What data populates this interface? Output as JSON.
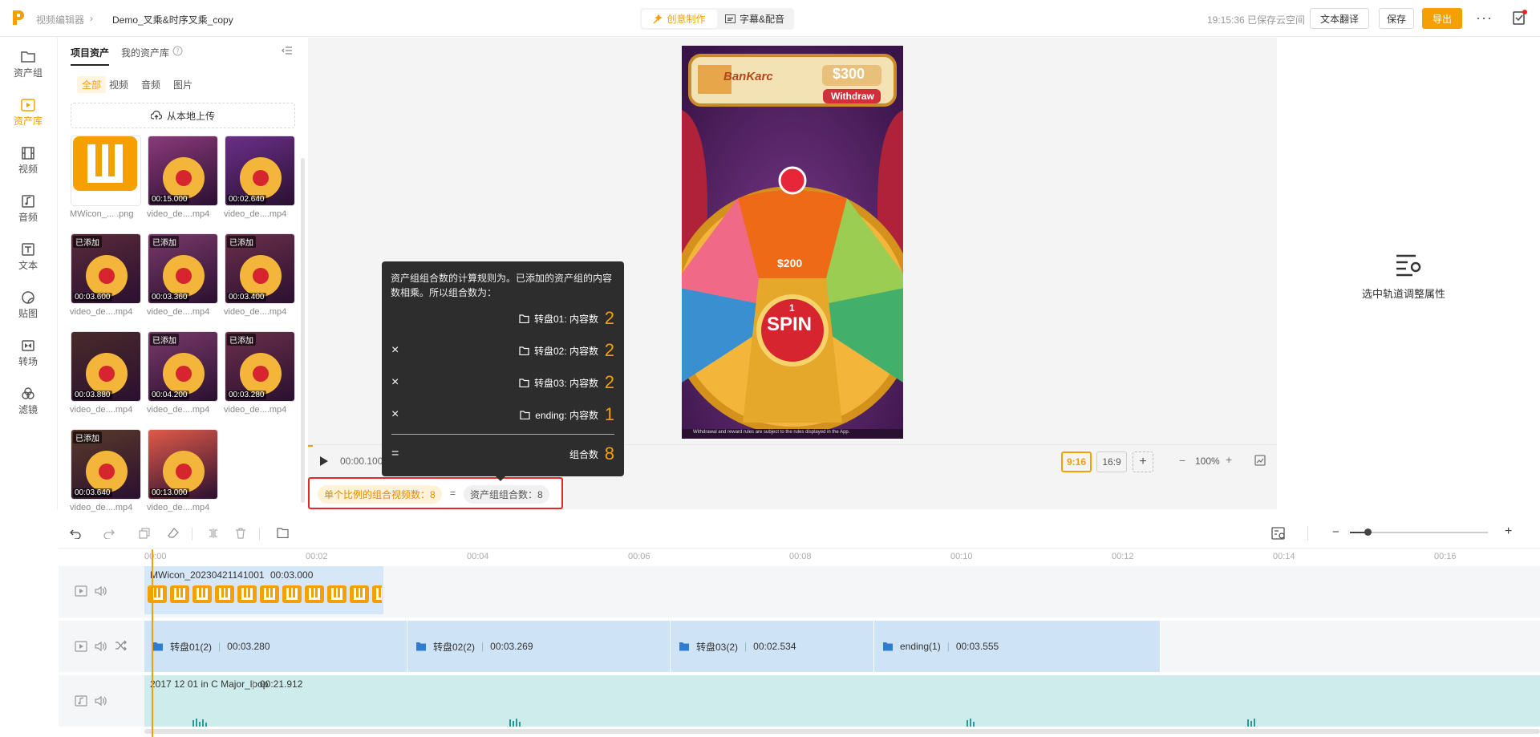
{
  "topbar": {
    "breadcrumb_root": "视频编辑器",
    "project_name": "Demo_叉乘&时序叉乘_copy",
    "mode_creative": "创意制作",
    "mode_subtitle": "字幕&配音",
    "save_status": "19:15:36 已保存云空间",
    "translate_label": "文本翻译",
    "save_label": "保存",
    "export_label": "导出"
  },
  "leftnav": {
    "items": [
      {
        "label": "资产组"
      },
      {
        "label": "资产库"
      },
      {
        "label": "视频"
      },
      {
        "label": "音频"
      },
      {
        "label": "文本"
      },
      {
        "label": "贴图"
      },
      {
        "label": "转场"
      },
      {
        "label": "滤镜"
      }
    ]
  },
  "assets": {
    "tab_project": "项目资产",
    "tab_mine": "我的资产库",
    "filters": [
      "全部",
      "视频",
      "音频",
      "图片"
    ],
    "upload_label": "从本地上传",
    "added_tag": "已添加",
    "items": [
      {
        "name": "MWicon_... .png",
        "duration": "",
        "added": false
      },
      {
        "name": "video_de....mp4",
        "duration": "00:15.000",
        "added": false
      },
      {
        "name": "video_de....mp4",
        "duration": "00:02.640",
        "added": false
      },
      {
        "name": "video_de....mp4",
        "duration": "00:03.600",
        "added": true
      },
      {
        "name": "video_de....mp4",
        "duration": "00:03.360",
        "added": true
      },
      {
        "name": "video_de....mp4",
        "duration": "00:03.400",
        "added": true
      },
      {
        "name": "video_de....mp4",
        "duration": "00:03.880",
        "added": false
      },
      {
        "name": "video_de....mp4",
        "duration": "00:04.200",
        "added": true
      },
      {
        "name": "video_de....mp4",
        "duration": "00:03.280",
        "added": true
      },
      {
        "name": "video_de....mp4",
        "duration": "00:03.640",
        "added": true
      },
      {
        "name": "video_de....mp4",
        "duration": "00:13.000",
        "added": false
      }
    ]
  },
  "preview": {
    "game_brand": "BanKarc",
    "game_amount": "$300",
    "game_withdraw": "Withdraw",
    "game_wheel_value": "$200",
    "game_spin_count": "1",
    "game_spin": "SPIN",
    "game_footer": "Withdrawal and reward rules are subject to the rules displayed in the App.",
    "time": "00:00.100",
    "ratio_active": "9:16",
    "ratio_other": "16:9",
    "zoom": "100%",
    "formula_left": "单个比例的组合视频数：8",
    "formula_eq": "=",
    "formula_right": "资产组组合数：8"
  },
  "popup": {
    "desc": "资产组组合数的计算规则为。已添加的资产组的内容数相乘。所以组合数为：",
    "rows": [
      {
        "op": "",
        "label": "转盘01: 内容数",
        "num": "2"
      },
      {
        "op": "×",
        "label": "转盘02: 内容数",
        "num": "2"
      },
      {
        "op": "×",
        "label": "转盘03: 内容数",
        "num": "2"
      },
      {
        "op": "×",
        "label": "ending: 内容数",
        "num": "1"
      }
    ],
    "total_op": "=",
    "total_label": "组合数",
    "total_num": "8"
  },
  "rightpanel": {
    "hint": "选中轨道调整属性"
  },
  "timeline": {
    "ruler": [
      "00:00",
      "00:02",
      "00:04",
      "00:06",
      "00:08",
      "00:10",
      "00:12",
      "00:14",
      "00:16"
    ],
    "sticker_clip": {
      "name": "MWicon_20230421141001",
      "duration": "00:03.000"
    },
    "group_clips": [
      {
        "name": "转盘01(2)",
        "duration": "00:03.280"
      },
      {
        "name": "转盘02(2)",
        "duration": "00:03.269"
      },
      {
        "name": "转盘03(2)",
        "duration": "00:02.534"
      },
      {
        "name": "ending(1)",
        "duration": "00:03.555"
      }
    ],
    "audio_clip": {
      "name": "2017 12 01 in C Major_loop",
      "duration": "00:21.912"
    }
  },
  "colors": {
    "accent": "#f5a000",
    "popup_bg": "#2d2d2d",
    "clip_blue": "#cfe3f7",
    "audio_teal": "#cdeceb",
    "highlight_red": "#e8262a"
  }
}
